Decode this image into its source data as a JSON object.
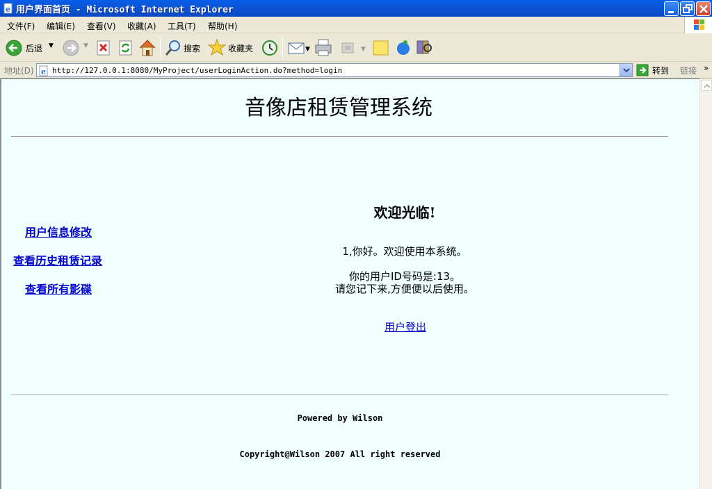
{
  "window": {
    "title": "用户界面首页 - Microsoft Internet Explorer"
  },
  "menu": {
    "items": [
      "文件(F)",
      "编辑(E)",
      "查看(V)",
      "收藏(A)",
      "工具(T)",
      "帮助(H)"
    ]
  },
  "toolbar": {
    "back_label": "后退",
    "search_label": "搜索",
    "favorites_label": "收藏夹",
    "icons": [
      "back-icon",
      "forward-icon",
      "stop-icon",
      "refresh-icon",
      "home-icon",
      "search-icon",
      "favorites-icon",
      "history-icon",
      "mail-icon",
      "print-icon",
      "edit-icon",
      "note-icon",
      "messenger-icon",
      "research-icon"
    ]
  },
  "address": {
    "label": "地址(D)",
    "url": "http://127.0.0.1:8080/MyProject/userLoginAction.do?method=login",
    "go_label": "转到",
    "links_label": "链接"
  },
  "page": {
    "title": "音像店租赁管理系统",
    "nav": [
      {
        "label": "用户信息修改"
      },
      {
        "label": "查看历史租赁记录"
      },
      {
        "label": "查看所有影碟"
      }
    ],
    "welcome_heading": "欢迎光临!",
    "greeting": "1,你好。欢迎使用本系统。",
    "user_id_line": "你的用户ID号码是:13。",
    "remember_line": "请您记下来,方便便以后使用。",
    "logout_label": "用户登出",
    "powered_by": "Powered by Wilson",
    "copyright": "Copyright@Wilson 2007 All right reserved"
  },
  "colors": {
    "titlebar": "#0b55d6",
    "page_background": "#f0ffff",
    "link": "#0000cc",
    "chrome": "#ece9d8"
  }
}
